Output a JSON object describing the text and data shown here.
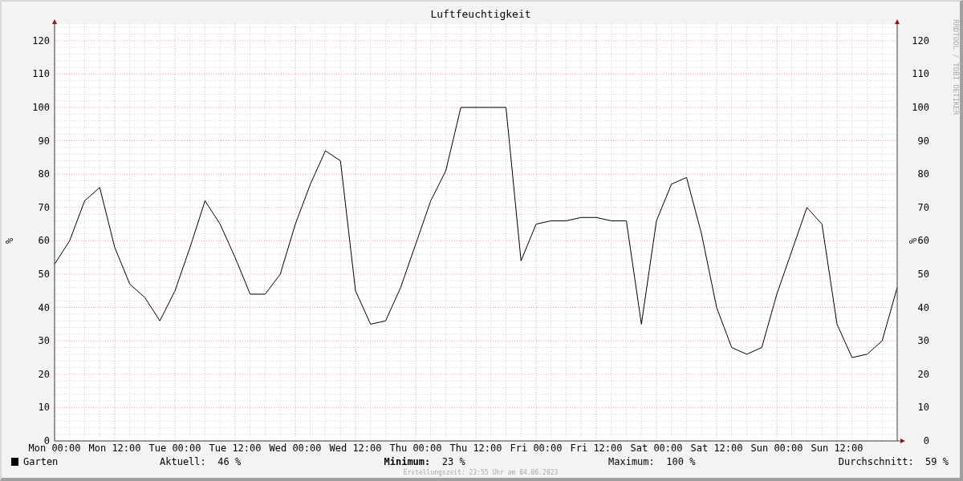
{
  "title": "Luftfeuchtigkeit",
  "credit": "RRDTOOL / TOBI OETIKER",
  "chart_data": {
    "type": "line",
    "grid": true,
    "ylabel": "%",
    "ylim": [
      0,
      125
    ],
    "categories": [
      "Mon 00:00",
      null,
      null,
      null,
      "Mon 12:00",
      null,
      null,
      null,
      "Tue 00:00",
      null,
      null,
      null,
      "Tue 12:00",
      null,
      null,
      null,
      "Wed 00:00",
      null,
      null,
      null,
      "Wed 12:00",
      null,
      null,
      null,
      "Thu 00:00",
      null,
      null,
      null,
      "Thu 12:00",
      null,
      null,
      null,
      "Fri 00:00",
      null,
      null,
      null,
      "Fri 12:00",
      null,
      null,
      null,
      "Sat 00:00",
      null,
      null,
      null,
      "Sat 12:00",
      null,
      null,
      null,
      "Sun 00:00",
      null,
      null,
      null,
      "Sun 12:00",
      null,
      null,
      null,
      null
    ],
    "series": [
      {
        "name": "Garten",
        "color": "#000000",
        "values": [
          53,
          60,
          72,
          76,
          58,
          47,
          43,
          36,
          45,
          58,
          72,
          65,
          55,
          44,
          44,
          50,
          65,
          77,
          87,
          84,
          45,
          35,
          36,
          46,
          59,
          72,
          81,
          100,
          100,
          100,
          100,
          54,
          65,
          66,
          66,
          67,
          67,
          66,
          66,
          35,
          66,
          77,
          79,
          62,
          40,
          28,
          26,
          28,
          44,
          57,
          70,
          65,
          35,
          25,
          26,
          30,
          46
        ]
      }
    ],
    "yticks": [
      0,
      10,
      20,
      30,
      40,
      50,
      60,
      70,
      80,
      90,
      100,
      110,
      120
    ]
  },
  "right_axis": {
    "label": "%",
    "ticks": [
      "120",
      "110",
      "100",
      "90",
      "80",
      "70",
      "60",
      "50",
      "40",
      "30",
      "20",
      "10",
      "0"
    ]
  },
  "legend": {
    "stats": [
      {
        "label": "Aktuell:",
        "value": "46 %",
        "emphasized": false
      },
      {
        "label": "Minimum:",
        "value": "23 %",
        "emphasized": true
      },
      {
        "label": "Maximum:",
        "value": "100 %",
        "emphasized": false
      },
      {
        "label": "Durchschnitt:",
        "value": "59 %",
        "emphasized": false
      }
    ]
  },
  "footer": "Erstellungszeit: 23:55 Uhr am 04.06.2023"
}
